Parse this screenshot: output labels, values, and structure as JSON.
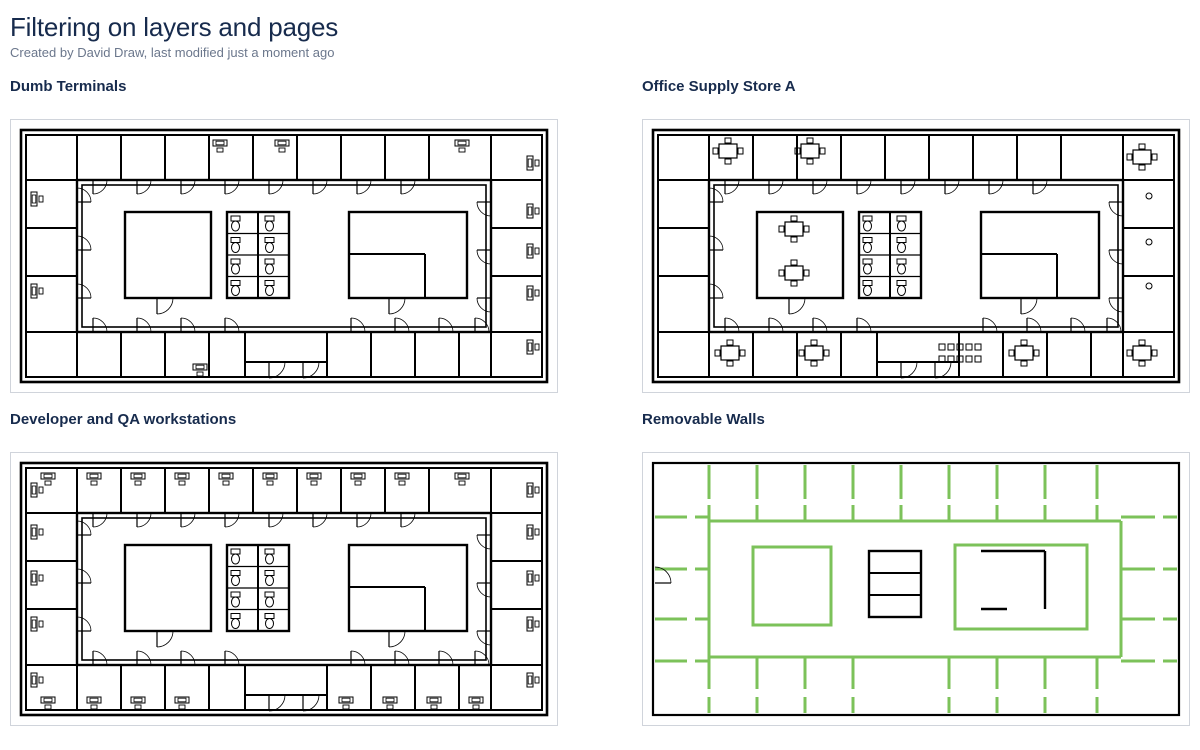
{
  "page": {
    "title": "Filtering on layers and pages",
    "byline": "Created by David Draw, last modified just a moment ago"
  },
  "panels": [
    {
      "title": "Dumb Terminals",
      "variant": "terminals"
    },
    {
      "title": "Office Supply Store A",
      "variant": "furniture"
    },
    {
      "title": "Developer and QA workstations",
      "variant": "workstations"
    },
    {
      "title": "Removable Walls",
      "variant": "removable"
    }
  ]
}
